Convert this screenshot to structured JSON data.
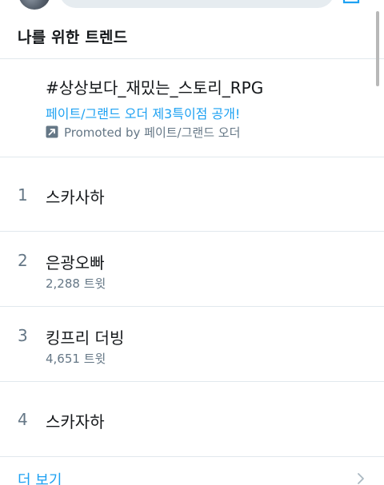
{
  "colors": {
    "accent": "#1da1f2",
    "text_primary": "#14171a",
    "text_secondary": "#657786",
    "divider": "#e1e8ed",
    "search_bg": "#e6ecf0"
  },
  "header": {
    "avatar_icon": "user-avatar",
    "search_icon": "search-bar",
    "compose_icon": "compose-icon"
  },
  "section": {
    "title": "나를 위한 트렌드"
  },
  "promoted": {
    "hashtag": "#상상보다_재밌는_스토리_RPG",
    "description": "페이트/그랜드 오더 제3특이점 공개!",
    "promoted_by": "Promoted by 페이트/그랜드 오더",
    "icon": "promoted-icon"
  },
  "trends": [
    {
      "rank": "1",
      "name": "스카사하",
      "count": ""
    },
    {
      "rank": "2",
      "name": "은광오빠",
      "count": "2,288 트윗"
    },
    {
      "rank": "3",
      "name": "킹프리 더빙",
      "count": "4,651 트윗"
    },
    {
      "rank": "4",
      "name": "스카자하",
      "count": ""
    }
  ],
  "footer": {
    "more_label": "더 보기",
    "chevron_icon": "chevron-right-icon"
  }
}
